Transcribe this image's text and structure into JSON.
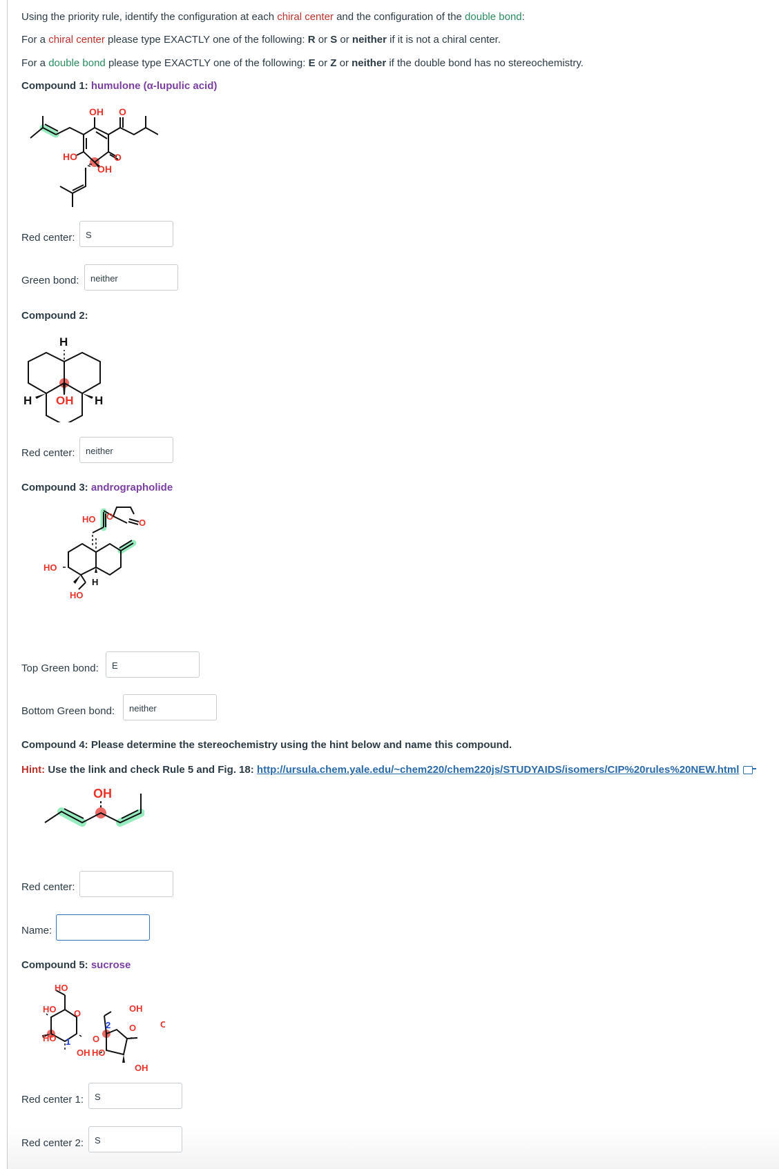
{
  "instructions": {
    "line1": {
      "pre": "Using the priority rule, identify the configuration at each ",
      "chiral": "chiral center",
      "mid": " and the configuration of the ",
      "double": "double bond",
      "post": ":"
    },
    "line2": {
      "pre": "For a ",
      "chiral": "chiral center",
      "mid": " please type EXACTLY one of the following: ",
      "opt1": "R",
      "or1": " or ",
      "opt2": "S",
      "or2": " or ",
      "opt3": "neither",
      "post": " if it is not a chiral center."
    },
    "line3": {
      "pre": "For a ",
      "double": "double bond",
      "mid": " please type EXACTLY one of the following: ",
      "opt1": "E",
      "or1": " or ",
      "opt2": "Z",
      "or2": " or ",
      "opt3": "neither",
      "post": " if the double bond has no stereochemistry."
    }
  },
  "compounds": [
    {
      "heading": "Compound 1:",
      "name": "humulone (α-lupulic acid)",
      "fields": [
        {
          "label": "Red center:",
          "value": "S"
        },
        {
          "label": "Green bond:",
          "value": "neither"
        }
      ],
      "atoms": {
        "oh_top": "OH",
        "o_top": "O",
        "ho_left": "HO",
        "o_right": "O",
        "oh_bottom": "OH"
      }
    },
    {
      "heading": "Compound 2:",
      "name": "",
      "fields": [
        {
          "label": "Red center:",
          "value": "neither"
        }
      ],
      "atoms": {
        "h_top": "H",
        "h_left": "H",
        "oh": "OH",
        "h_right": "H"
      }
    },
    {
      "heading": "Compound 3:",
      "name": "andrographolide",
      "fields": [
        {
          "label": "Top Green bond:",
          "value": "E"
        },
        {
          "label": "Bottom Green bond:",
          "value": "neither"
        }
      ],
      "atoms": {
        "o_ring": "O",
        "ho_top": "HO",
        "o_keto": "O",
        "ho_left": "HO",
        "h": "H",
        "ho_bottom": "HO"
      }
    },
    {
      "heading": "Compound 4: Please determine the stereochemistry using the hint below and name this compound.",
      "name": "",
      "hint_label": "Hint:",
      "hint_text": " Use the link and check Rule 5 and Fig. 18: ",
      "hint_link": "http://ursula.chem.yale.edu/~chem220/chem220js/STUDYAIDS/isomers/CIP%20rules%20NEW.html",
      "fields": [
        {
          "label": "Red center:",
          "value": ""
        },
        {
          "label": "Name:",
          "value": ""
        }
      ],
      "atoms": {
        "oh": "OH"
      }
    },
    {
      "heading": "Compound 5:",
      "name": "sucrose",
      "fields": [
        {
          "label": "Red center 1:",
          "value": "S"
        },
        {
          "label": "Red center 2:",
          "value": "S"
        }
      ],
      "atoms": {
        "ho1": "HO",
        "ho2": "HO",
        "ho3": "HO",
        "o_ring1": "O",
        "oh_bottom1": "OH",
        "ho4": "HO",
        "o_link": "O",
        "num1": "1",
        "num2": "2",
        "oh_top2": "OH",
        "o_ring2": "O",
        "oh_right": "OH",
        "oh_bottom2": "OH"
      }
    }
  ],
  "colors": {
    "chiral_red": "#b8312b",
    "bond_green": "#2b8a5e",
    "name_purple": "#7a3fa0",
    "atom_red": "#e8332a",
    "highlight_green": "#7ee8b0",
    "center_red": "#e8504a",
    "number_blue": "#1f3fd6"
  }
}
